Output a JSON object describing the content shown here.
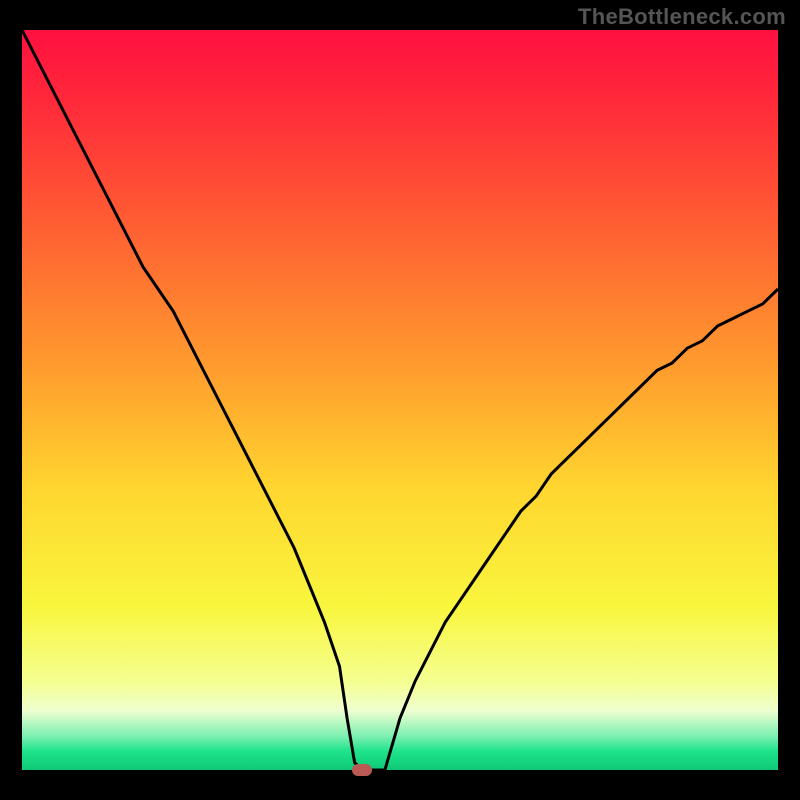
{
  "watermark": {
    "text": "TheBottleneck.com"
  },
  "chart_data": {
    "type": "line",
    "x": [
      0,
      2,
      4,
      6,
      8,
      10,
      12,
      14,
      16,
      18,
      20,
      22,
      24,
      26,
      28,
      30,
      32,
      34,
      36,
      38,
      40,
      42,
      43,
      44,
      45,
      46,
      48,
      50,
      52,
      54,
      56,
      58,
      60,
      62,
      64,
      66,
      68,
      70,
      72,
      74,
      76,
      78,
      80,
      82,
      84,
      86,
      88,
      90,
      92,
      94,
      96,
      98,
      100
    ],
    "values": [
      100,
      96,
      92,
      88,
      84,
      80,
      76,
      72,
      68,
      65,
      62,
      58,
      54,
      50,
      46,
      42,
      38,
      34,
      30,
      25,
      20,
      14,
      7,
      1,
      0,
      0,
      0,
      7,
      12,
      16,
      20,
      23,
      26,
      29,
      32,
      35,
      37,
      40,
      42,
      44,
      46,
      48,
      50,
      52,
      54,
      55,
      57,
      58,
      60,
      61,
      62,
      63,
      65
    ],
    "title": "",
    "xlabel": "",
    "ylabel": "",
    "xlim": [
      0,
      100
    ],
    "ylim": [
      0,
      100
    ],
    "stroke_color": "#000000",
    "stroke_width": 3,
    "background_gradient": {
      "type": "linear-vertical",
      "stops": [
        {
          "pos": 0.0,
          "color": "#ff1040"
        },
        {
          "pos": 0.1,
          "color": "#ff2a3a"
        },
        {
          "pos": 0.25,
          "color": "#ff5a33"
        },
        {
          "pos": 0.45,
          "color": "#ff9a2e"
        },
        {
          "pos": 0.62,
          "color": "#ffd62f"
        },
        {
          "pos": 0.78,
          "color": "#f9f63e"
        },
        {
          "pos": 0.88,
          "color": "#f5ff90"
        },
        {
          "pos": 0.92,
          "color": "#eeffd0"
        },
        {
          "pos": 0.955,
          "color": "#7aefb0"
        },
        {
          "pos": 0.975,
          "color": "#1de38a"
        },
        {
          "pos": 1.0,
          "color": "#0fc878"
        }
      ]
    },
    "markers": [
      {
        "x": 45.0,
        "y": 0.0,
        "color": "#bb5a55",
        "shape": "pill"
      }
    ]
  }
}
